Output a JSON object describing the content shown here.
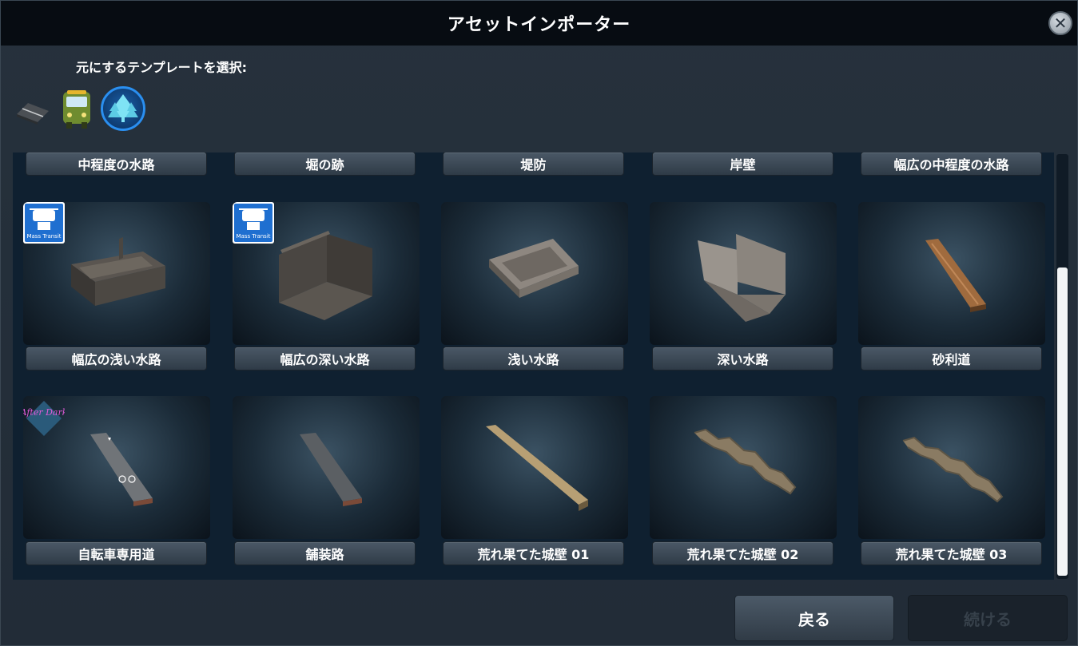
{
  "window": {
    "title": "アセットインポーター",
    "close_icon": "close-icon"
  },
  "template_picker": {
    "label": "元にするテンプレートを選択:",
    "categories": [
      {
        "name": "roads",
        "icon": "road-icon",
        "selected": false
      },
      {
        "name": "transport",
        "icon": "bus-icon",
        "selected": false
      },
      {
        "name": "parks",
        "icon": "tree-icon",
        "selected": true
      }
    ]
  },
  "assets": {
    "top_row_labels": [
      "中程度の水路",
      "堀の跡",
      "堤防",
      "岸壁",
      "幅広の中程度の水路"
    ],
    "items": [
      {
        "label": "幅広の浅い水路",
        "badge": "Mass Transit"
      },
      {
        "label": "幅広の深い水路",
        "badge": "Mass Transit"
      },
      {
        "label": "浅い水路",
        "badge": ""
      },
      {
        "label": "深い水路",
        "badge": ""
      },
      {
        "label": "砂利道",
        "badge": ""
      },
      {
        "label": "自転車専用道",
        "badge": "After Dark"
      },
      {
        "label": "舗装路",
        "badge": ""
      },
      {
        "label": "荒れ果てた城壁 01",
        "badge": ""
      },
      {
        "label": "荒れ果てた城壁 02",
        "badge": ""
      },
      {
        "label": "荒れ果てた城壁 03",
        "badge": ""
      }
    ],
    "badge_mass_transit_text": "Mass Transit",
    "badge_after_dark_text": "After Dark"
  },
  "footer": {
    "back_label": "戻る",
    "continue_label": "続ける",
    "continue_enabled": false
  },
  "colors": {
    "accent_blue": "#1f6fd0",
    "after_dark_pink": "#e05ad8"
  }
}
